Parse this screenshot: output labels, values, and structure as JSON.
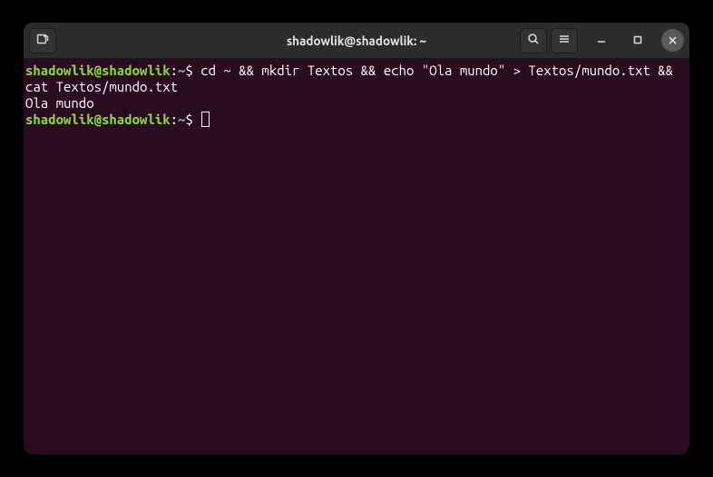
{
  "window": {
    "title": "shadowlik@shadowlik: ~"
  },
  "terminal": {
    "prompt1": {
      "user_host": "shadowlik@shadowlik",
      "colon": ":",
      "path": "~",
      "dollar": "$ ",
      "command": "cd ~ && mkdir Textos && echo \"Ola mundo\" > Textos/mundo.txt && cat Textos/mundo.txt"
    },
    "output1": "Ola mundo",
    "prompt2": {
      "user_host": "shadowlik@shadowlik",
      "colon": ":",
      "path": "~",
      "dollar": "$ "
    }
  },
  "icons": {
    "new_tab": "new-tab-icon",
    "search": "search-icon",
    "menu": "hamburger-menu-icon",
    "minimize": "minimize-icon",
    "maximize": "maximize-icon",
    "close": "close-icon"
  }
}
